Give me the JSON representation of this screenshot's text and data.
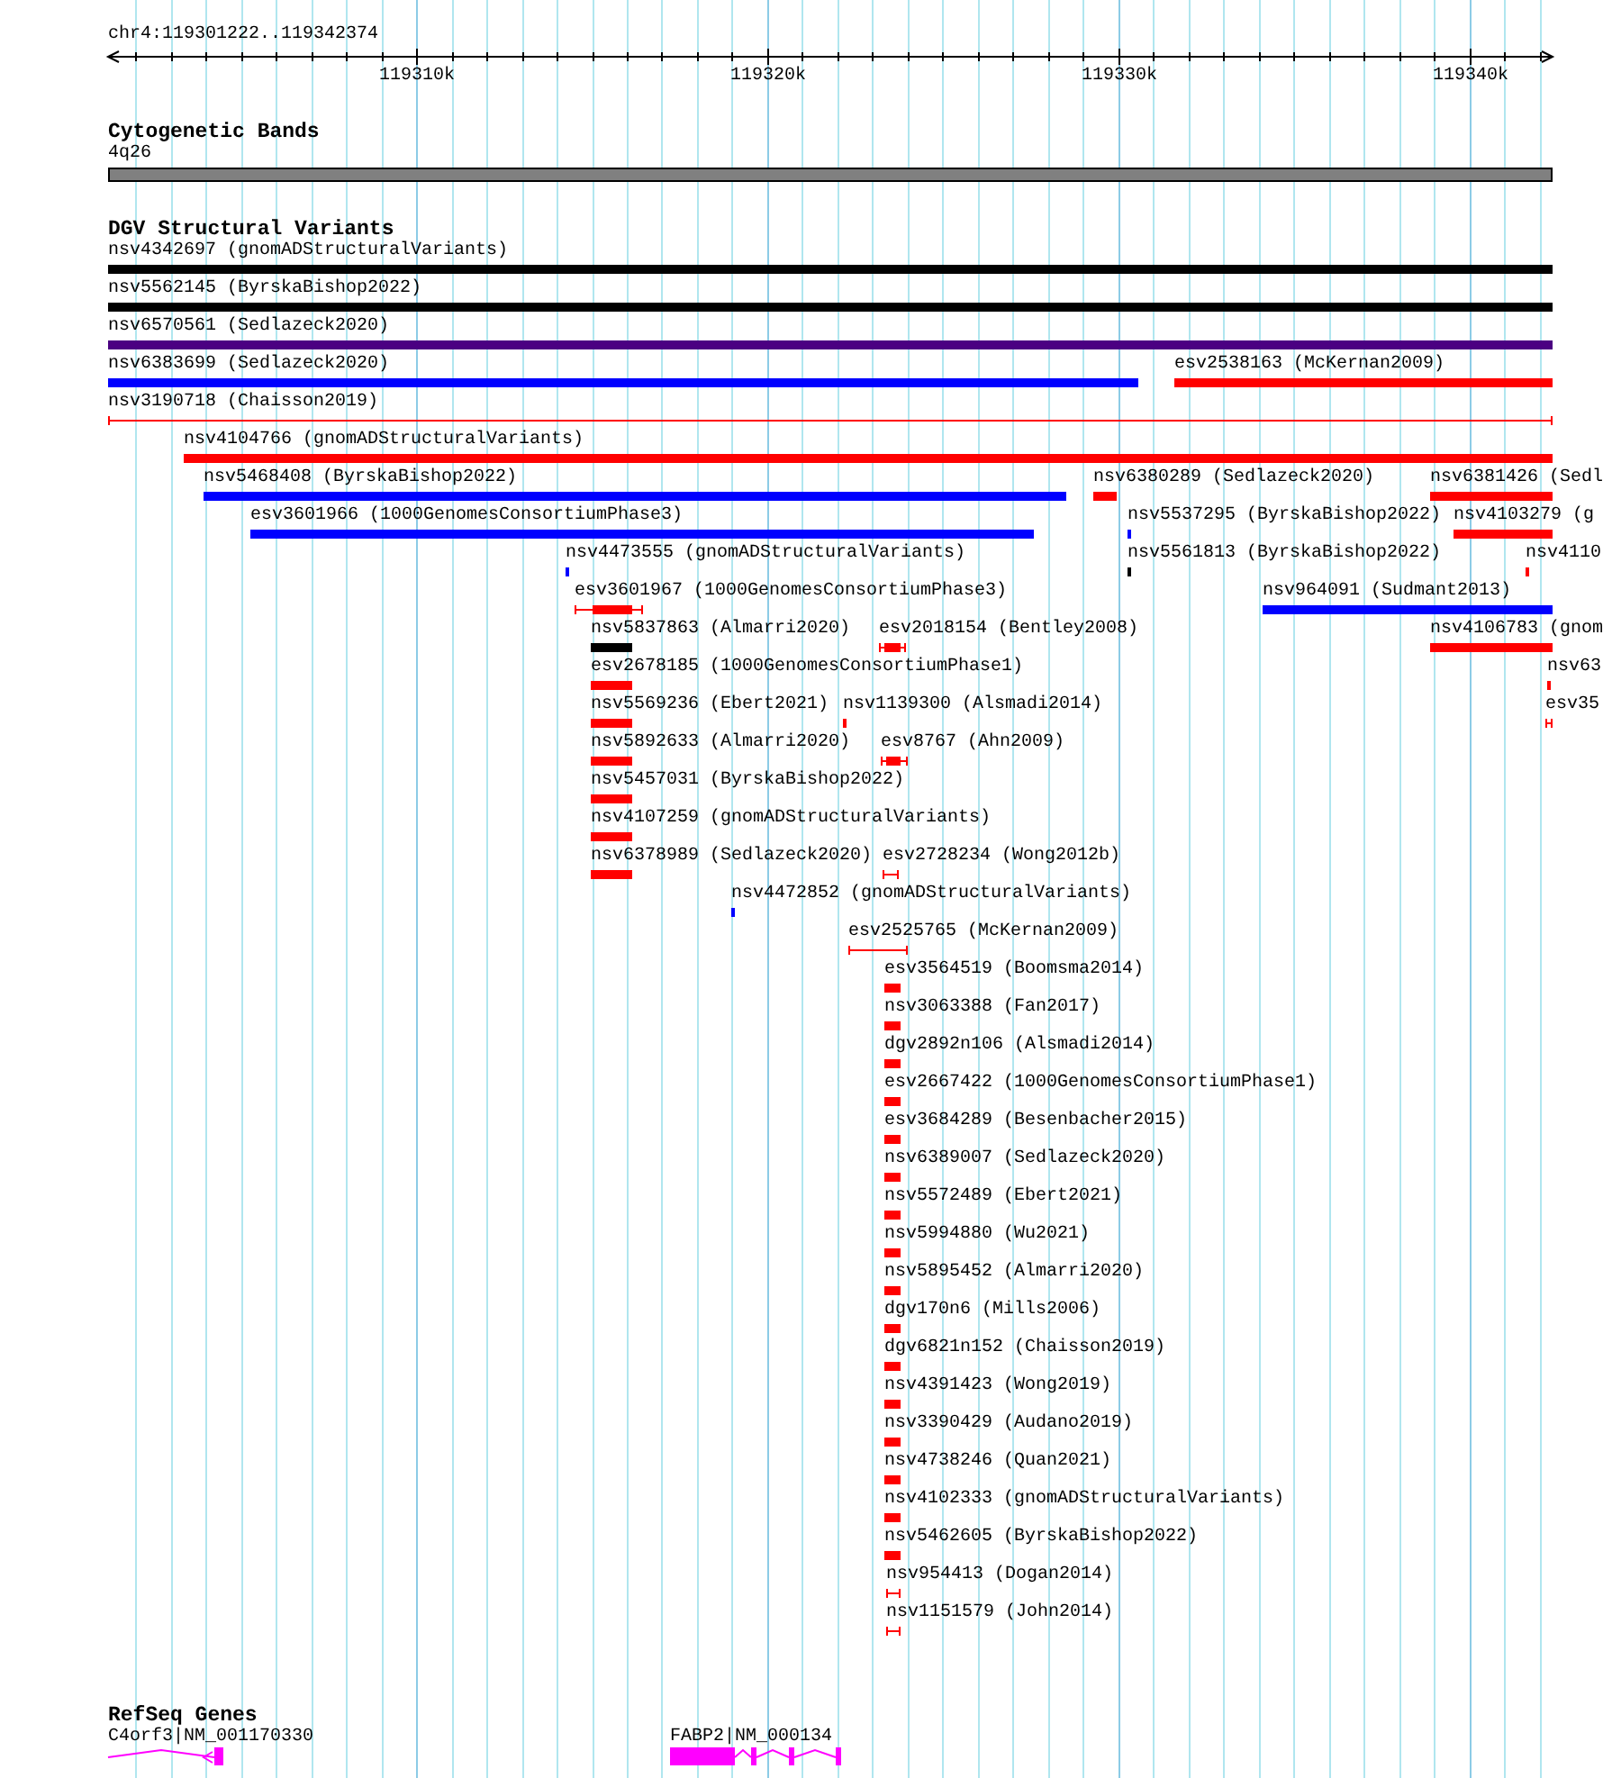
{
  "ruler": {
    "label": "chr4:119301222..119342374",
    "ticks": [
      "119310k",
      "119320k",
      "119330k",
      "119340k"
    ]
  },
  "tracks": [
    {
      "kind": "cytoband",
      "title": "Cytogenetic Bands",
      "band": "4q26"
    },
    {
      "kind": "variants",
      "title": "DGV Structural Variants",
      "rows": [
        {
          "features": [
            {
              "label": "nsv4342697 (gnomADStructuralVariants)",
              "kind": "bar",
              "color": "#000000"
            }
          ]
        },
        {
          "features": [
            {
              "label": "nsv5562145 (ByrskaBishop2022)",
              "kind": "bar",
              "color": "#000000"
            }
          ]
        },
        {
          "features": [
            {
              "label": "nsv6570561 (Sedlazeck2020)",
              "kind": "bar",
              "color": "#4b0082"
            }
          ]
        },
        {
          "features": [
            {
              "label": "nsv6383699 (Sedlazeck2020)",
              "kind": "bar",
              "color": "#0000ff"
            },
            {
              "label": "esv2538163 (McKernan2009)",
              "kind": "bar",
              "color": "#ff0000"
            }
          ]
        },
        {
          "features": [
            {
              "label": "nsv3190718 (Chaisson2019)",
              "kind": "span",
              "color": "#ff0000"
            }
          ]
        },
        {
          "features": [
            {
              "label": "nsv4104766 (gnomADStructuralVariants)",
              "kind": "bar",
              "color": "#ff0000"
            }
          ]
        },
        {
          "features": [
            {
              "label": "nsv5468408 (ByrskaBishop2022)",
              "kind": "bar",
              "color": "#0000ff"
            },
            {
              "label": "nsv6380289 (Sedlazeck2020)",
              "kind": "bar",
              "color": "#ff0000"
            },
            {
              "label": "nsv6381426 (Sedl",
              "kind": "bar",
              "color": "#ff0000"
            }
          ]
        },
        {
          "features": [
            {
              "label": "esv3601966 (1000GenomesConsortiumPhase3)",
              "kind": "bar",
              "color": "#0000ff"
            },
            {
              "label": "nsv5537295 (ByrskaBishop2022)",
              "kind": "bar",
              "color": "#0000ff"
            },
            {
              "label": "nsv4103279 (g",
              "kind": "bar",
              "color": "#ff0000"
            }
          ]
        },
        {
          "features": [
            {
              "label": "nsv4473555 (gnomADStructuralVariants)",
              "kind": "bar",
              "color": "#0000ff"
            },
            {
              "label": "nsv5561813 (ByrskaBishop2022)",
              "kind": "bar",
              "color": "#000000"
            },
            {
              "label": "nsv4110",
              "kind": "bar",
              "color": "#ff0000"
            }
          ]
        },
        {
          "features": [
            {
              "label": "esv3601967 (1000GenomesConsortiumPhase3)",
              "kind": "span",
              "color": "#ff0000"
            },
            {
              "label": "nsv964091 (Sudmant2013)",
              "kind": "bar",
              "color": "#0000ff"
            }
          ]
        },
        {
          "features": [
            {
              "label": "nsv5837863 (Almarri2020)",
              "kind": "bar",
              "color": "#000000"
            },
            {
              "label": "esv2018154 (Bentley2008)",
              "kind": "span",
              "color": "#ff0000"
            },
            {
              "label": "nsv4106783 (gnom",
              "kind": "bar",
              "color": "#ff0000"
            }
          ]
        },
        {
          "features": [
            {
              "label": "esv2678185 (1000GenomesConsortiumPhase1)",
              "kind": "bar",
              "color": "#ff0000"
            },
            {
              "label": "nsv63",
              "kind": "bar",
              "color": "#ff0000"
            }
          ]
        },
        {
          "features": [
            {
              "label": "nsv5569236 (Ebert2021)",
              "kind": "bar",
              "color": "#ff0000"
            },
            {
              "label": "nsv1139300 (Alsmadi2014)",
              "kind": "bar",
              "color": "#ff0000"
            },
            {
              "label": "esv35",
              "kind": "span",
              "color": "#ff0000"
            }
          ]
        },
        {
          "features": [
            {
              "label": "nsv5892633 (Almarri2020)",
              "kind": "bar",
              "color": "#ff0000"
            },
            {
              "label": "esv8767 (Ahn2009)",
              "kind": "span",
              "color": "#ff0000"
            }
          ]
        },
        {
          "features": [
            {
              "label": "nsv5457031 (ByrskaBishop2022)",
              "kind": "bar",
              "color": "#ff0000"
            }
          ]
        },
        {
          "features": [
            {
              "label": "nsv4107259 (gnomADStructuralVariants)",
              "kind": "bar",
              "color": "#ff0000"
            }
          ]
        },
        {
          "features": [
            {
              "label": "nsv6378989 (Sedlazeck2020)",
              "kind": "bar",
              "color": "#ff0000"
            },
            {
              "label": "esv2728234 (Wong2012b)",
              "kind": "span",
              "color": "#ff0000"
            }
          ]
        },
        {
          "features": [
            {
              "label": "nsv4472852 (gnomADStructuralVariants)",
              "kind": "bar",
              "color": "#0000ff"
            }
          ]
        },
        {
          "features": [
            {
              "label": "esv2525765 (McKernan2009)",
              "kind": "span",
              "color": "#ff0000"
            }
          ]
        },
        {
          "features": [
            {
              "label": "esv3564519 (Boomsma2014)",
              "kind": "bar",
              "color": "#ff0000"
            }
          ]
        },
        {
          "features": [
            {
              "label": "nsv3063388 (Fan2017)",
              "kind": "bar",
              "color": "#ff0000"
            }
          ]
        },
        {
          "features": [
            {
              "label": "dgv2892n106 (Alsmadi2014)",
              "kind": "bar",
              "color": "#ff0000"
            }
          ]
        },
        {
          "features": [
            {
              "label": "esv2667422 (1000GenomesConsortiumPhase1)",
              "kind": "bar",
              "color": "#ff0000"
            }
          ]
        },
        {
          "features": [
            {
              "label": "esv3684289 (Besenbacher2015)",
              "kind": "bar",
              "color": "#ff0000"
            }
          ]
        },
        {
          "features": [
            {
              "label": "nsv6389007 (Sedlazeck2020)",
              "kind": "bar",
              "color": "#ff0000"
            }
          ]
        },
        {
          "features": [
            {
              "label": "nsv5572489 (Ebert2021)",
              "kind": "bar",
              "color": "#ff0000"
            }
          ]
        },
        {
          "features": [
            {
              "label": "nsv5994880 (Wu2021)",
              "kind": "bar",
              "color": "#ff0000"
            }
          ]
        },
        {
          "features": [
            {
              "label": "nsv5895452 (Almarri2020)",
              "kind": "bar",
              "color": "#ff0000"
            }
          ]
        },
        {
          "features": [
            {
              "label": "dgv170n6 (Mills2006)",
              "kind": "bar",
              "color": "#ff0000"
            }
          ]
        },
        {
          "features": [
            {
              "label": "dgv6821n152 (Chaisson2019)",
              "kind": "bar",
              "color": "#ff0000"
            }
          ]
        },
        {
          "features": [
            {
              "label": "nsv4391423 (Wong2019)",
              "kind": "bar",
              "color": "#ff0000"
            }
          ]
        },
        {
          "features": [
            {
              "label": "nsv3390429 (Audano2019)",
              "kind": "bar",
              "color": "#ff0000"
            }
          ]
        },
        {
          "features": [
            {
              "label": "nsv4738246 (Quan2021)",
              "kind": "bar",
              "color": "#ff0000"
            }
          ]
        },
        {
          "features": [
            {
              "label": "nsv4102333 (gnomADStructuralVariants)",
              "kind": "bar",
              "color": "#ff0000"
            }
          ]
        },
        {
          "features": [
            {
              "label": "nsv5462605 (ByrskaBishop2022)",
              "kind": "bar",
              "color": "#ff0000"
            }
          ]
        },
        {
          "features": [
            {
              "label": "nsv954413 (Dogan2014)",
              "kind": "span",
              "color": "#ff0000"
            }
          ]
        },
        {
          "features": [
            {
              "label": "nsv1151579 (John2014)",
              "kind": "span",
              "color": "#ff0000"
            }
          ]
        }
      ]
    },
    {
      "kind": "genes",
      "title": "RefSeq Genes",
      "genes": [
        {
          "label": "C4orf3|NM_001170330",
          "arrow": true
        },
        {
          "label": "FABP2|NM_000134",
          "arrow": false
        }
      ]
    }
  ]
}
